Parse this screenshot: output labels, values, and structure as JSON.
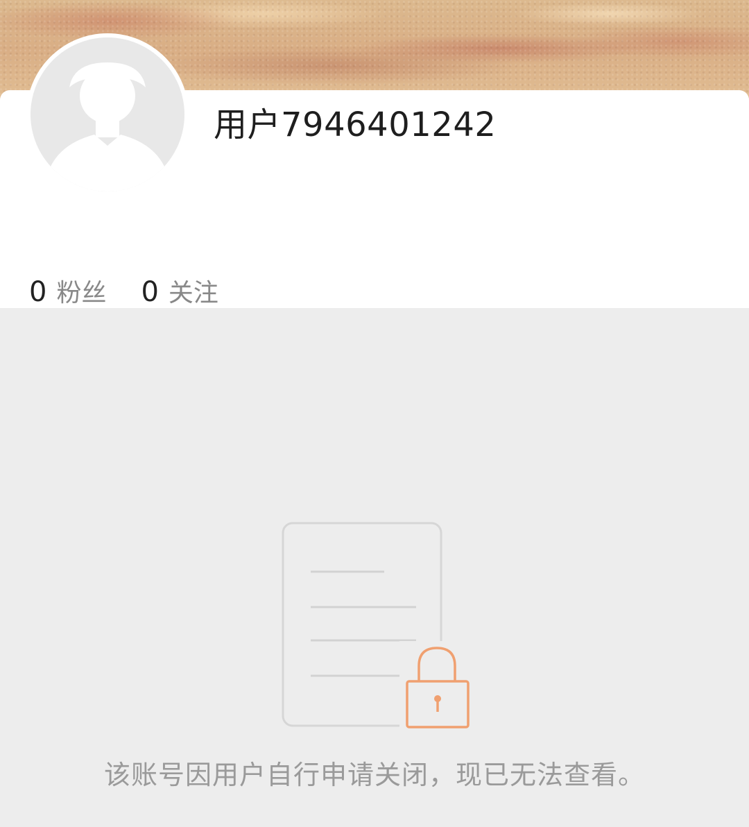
{
  "profile": {
    "username": "用户7946401242",
    "avatar_icon": "default-avatar-silhouette-icon"
  },
  "stats": {
    "followers": {
      "count": "0",
      "label": "粉丝"
    },
    "following": {
      "count": "0",
      "label": "关注"
    }
  },
  "empty_state": {
    "icon": "locked-document-icon",
    "message": "该账号因用户自行申请关闭，现已无法查看。"
  },
  "colors": {
    "accent_lock": "#f0a070",
    "background": "#ededed",
    "card": "#ffffff"
  }
}
